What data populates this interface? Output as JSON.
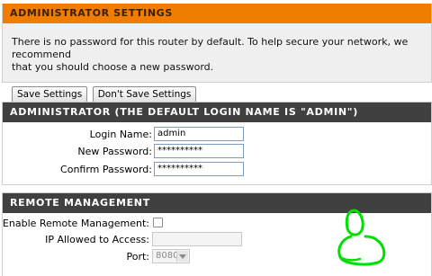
{
  "admin_settings": {
    "title": "ADMINISTRATOR SETTINGS",
    "description_line1": "There is no password for this router by default. To help secure your network, we recommend",
    "description_line2": "that you should choose a new password.",
    "save_label": "Save Settings",
    "dont_save_label": "Don't Save Settings",
    "header_color": "#f07c00"
  },
  "administrator": {
    "title": "ADMINISTRATOR (THE DEFAULT LOGIN NAME IS \"ADMIN\")",
    "login_name_label": "Login Name:",
    "login_name_value": "admin",
    "new_password_label": "New Password:",
    "new_password_value": "**********",
    "confirm_password_label": "Confirm Password:",
    "confirm_password_value": "**********"
  },
  "remote_management": {
    "title": "REMOTE MANAGEMENT",
    "enable_label": "Enable Remote Management:",
    "enable_checked": false,
    "ip_label": "IP Allowed to Access:",
    "ip_value": "",
    "port_label": "Port:",
    "port_value": "8080"
  },
  "annotation": {
    "type": "green-scribble-icon",
    "color": "#00e000"
  }
}
